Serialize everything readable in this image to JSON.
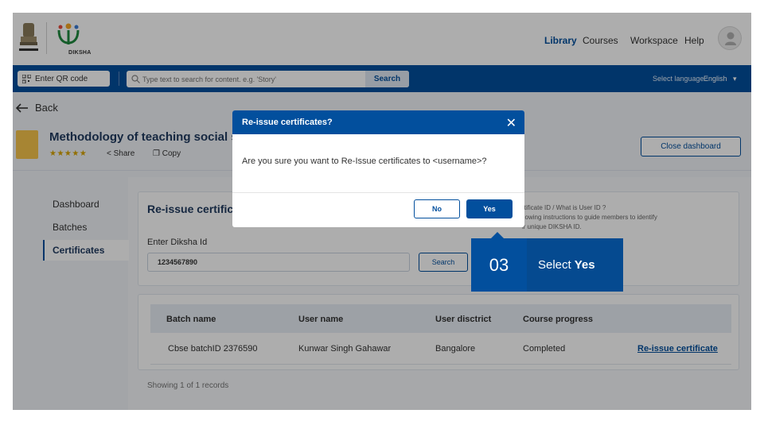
{
  "header": {
    "logo_text": "DIKSHA",
    "nav": [
      "Library",
      "Courses",
      "Workspace",
      "Help"
    ],
    "active_nav": "Library"
  },
  "toolbar": {
    "qr_label": "Enter QR code",
    "search_placeholder": "Type text to search for content. e.g. 'Story'",
    "search_label": "Search",
    "language_label": "Select language :",
    "language_value": "English"
  },
  "page": {
    "back_label": "Back",
    "course_title": "Methodology of teaching social sci",
    "share_label": "Share",
    "copy_label": "Copy",
    "close_dashboard_label": "Close dashboard"
  },
  "sidebar": {
    "items": [
      "Dashboard",
      "Batches",
      "Certificates"
    ],
    "active": "Certificates"
  },
  "reissue": {
    "title": "Re-issue certific",
    "enter_id_label": "Enter Diksha Id",
    "id_value": "1234567890",
    "search_label": "Search",
    "info_line1": "rtificate ID / What is User ID ?",
    "info_line2": "llowing instructions to guide members to identify",
    "info_line3": "ir unique DIKSHA ID."
  },
  "table": {
    "headers": [
      "Batch name",
      "User name",
      "User disctrict",
      "Course progress"
    ],
    "rows": [
      {
        "batch": "Cbse batchID 2376590",
        "user": "Kunwar Singh Gahawar",
        "district": "Bangalore",
        "progress": "Completed",
        "action": "Re-issue certificate"
      }
    ],
    "showing": "Showing 1 of 1 records"
  },
  "modal": {
    "title": "Re-issue certificates?",
    "message": "Are you sure you want to Re-Issue certificates to <username>?",
    "no_label": "No",
    "yes_label": "Yes"
  },
  "callout": {
    "step": "03",
    "text": "Select",
    "bold": "Yes"
  },
  "colors": {
    "primary": "#024f9d",
    "overlay": "rgba(0,0,0,0.32)",
    "stars": "#d8a400"
  }
}
